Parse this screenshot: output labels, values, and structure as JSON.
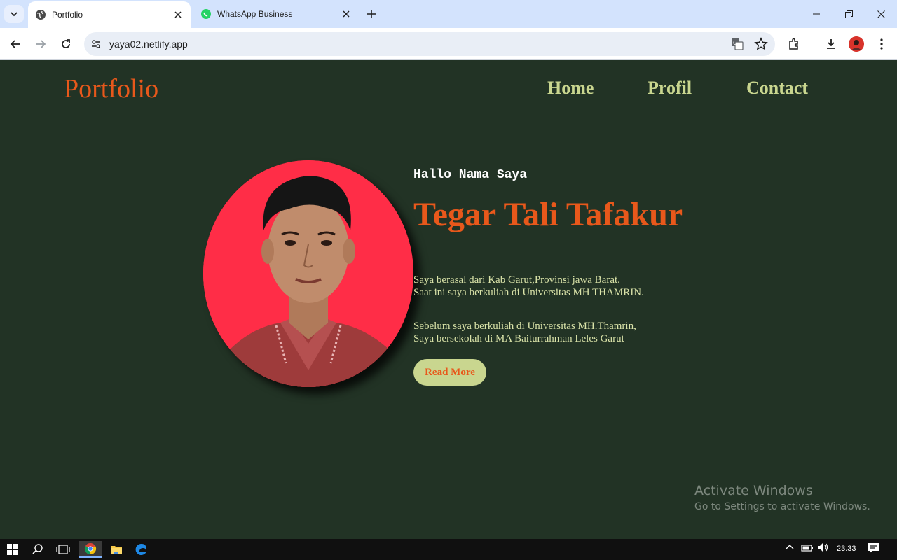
{
  "browser": {
    "tabs": [
      {
        "title": "Portfolio",
        "active": true
      },
      {
        "title": "WhatsApp Business",
        "active": false
      }
    ],
    "url": "yaya02.netlify.app"
  },
  "page": {
    "logo": "Portfolio",
    "nav": [
      "Home",
      "Profil",
      "Contact"
    ],
    "greeting": "Hallo Nama Saya",
    "name": "Tegar Tali Tafakur",
    "para1_line1": "Saya berasal dari Kab Garut,Provinsi jawa Barat.",
    "para1_line2": "Saat ini saya berkuliah di Universitas MH THAMRIN.",
    "para2_line1": "Sebelum saya berkuliah di Universitas MH.Thamrin,",
    "para2_line2": "Saya bersekolah di MA Baiturrahman Leles Garut",
    "button": "Read More"
  },
  "watermark": {
    "title": "Activate Windows",
    "subtitle": "Go to Settings to activate Windows."
  },
  "taskbar": {
    "time": "23.33"
  },
  "colors": {
    "background": "#223325",
    "accent_orange": "#e8581b",
    "nav_green": "#c9d68f",
    "photo_bg": "#ff2d47"
  }
}
